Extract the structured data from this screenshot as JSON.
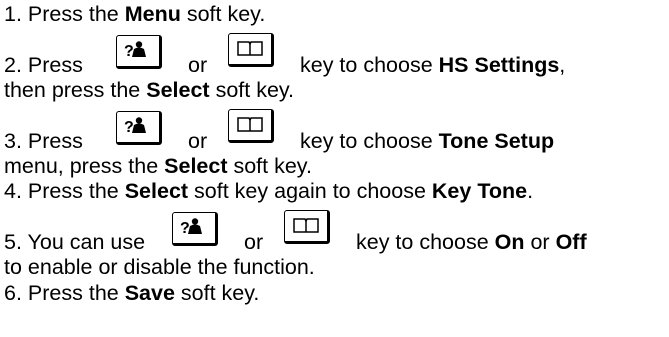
{
  "steps": [
    {
      "num": "1.",
      "parts": [
        "Press the ",
        "Menu",
        " soft key."
      ]
    },
    {
      "num": "2.",
      "pre": "Press",
      "or": "or",
      "post": "key to choose ",
      "bold1": "HS Settings",
      "tail": ",",
      "line2a": "then press the ",
      "line2b": "Select",
      "line2c": " soft key."
    },
    {
      "num": "3.",
      "pre": "Press",
      "or": "or",
      "post": "key to choose ",
      "bold1": "Tone Setup",
      "line2a": "menu, press the ",
      "line2b": "Select",
      "line2c": " soft key."
    },
    {
      "num": "4.",
      "parts": [
        "Press the ",
        "Select",
        " soft key again to choose ",
        "Key Tone",
        "."
      ]
    },
    {
      "num": "5.",
      "pre": "You can use",
      "or": "or",
      "post": "key to choose ",
      "bold1": "On",
      "mid": " or ",
      "bold2": "Off",
      "line2a": "to enable or disable the function."
    },
    {
      "num": "6.",
      "parts": [
        "Press the ",
        "Save",
        " soft key."
      ]
    }
  ],
  "keys": {
    "up": {
      "icon": "question-person-icon",
      "glyph": "?"
    },
    "down": {
      "icon": "phonebook-icon"
    }
  }
}
